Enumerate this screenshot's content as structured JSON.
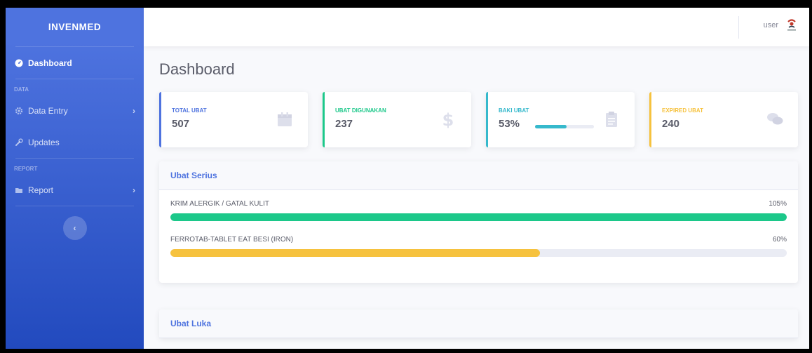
{
  "app": {
    "brand": "INVENMED"
  },
  "sidebar": {
    "items": [
      {
        "label": "Dashboard",
        "icon": "tachometer-icon"
      },
      {
        "label": "Data Entry",
        "icon": "cog-icon"
      },
      {
        "label": "Updates",
        "icon": "wrench-icon"
      },
      {
        "label": "Report",
        "icon": "folder-icon"
      }
    ],
    "headings": {
      "data": "DATA",
      "report": "REPORT"
    }
  },
  "topbar": {
    "user": "user"
  },
  "main": {
    "title": "Dashboard",
    "cards": [
      {
        "label": "TOTAL UBAT",
        "value": "507",
        "color": "#4e73df",
        "icon": "calendar-icon"
      },
      {
        "label": "UBAT DIGUNAKAN",
        "value": "237",
        "color": "#1cc88a",
        "icon": "dollar-icon"
      },
      {
        "label": "BAKI UBAT",
        "value": "53%",
        "color": "#36b9cc",
        "icon": "clipboard-icon",
        "progress": 0.53
      },
      {
        "label": "EXPIRED UBAT",
        "value": "240",
        "color": "#f6c23e",
        "icon": "comments-icon"
      }
    ],
    "panels": [
      {
        "title": "Ubat Serius",
        "rows": [
          {
            "name": "KRIM ALERGIK / GATAL KULIT",
            "pct_label": "105%",
            "fraction": 1.0,
            "color": "#1cc88a"
          },
          {
            "name": "FERROTAB-TABLET EAT BESI (IRON)",
            "pct_label": "60%",
            "fraction": 0.6,
            "color": "#f6c23e"
          }
        ]
      },
      {
        "title": "Ubat Luka"
      }
    ]
  }
}
